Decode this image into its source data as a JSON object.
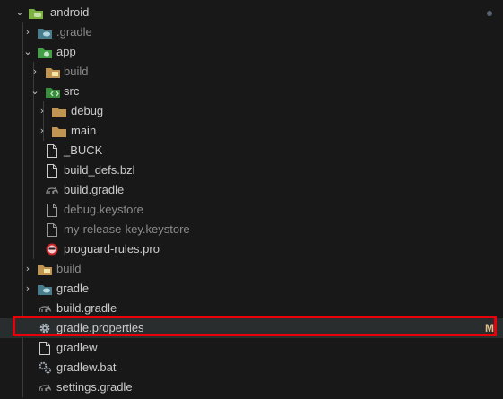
{
  "explorer": {
    "root": {
      "label": "android",
      "icon": "android-folder-icon",
      "expanded": true
    },
    "items": [
      {
        "label": "android",
        "icon": "android-folder-icon",
        "type": "folder",
        "expanded": true,
        "muted": false
      },
      {
        "label": ".gradle",
        "icon": "gradle-folder-icon",
        "type": "folder",
        "expanded": false,
        "muted": true
      },
      {
        "label": "app",
        "icon": "app-folder-icon",
        "type": "folder",
        "expanded": true,
        "muted": false
      },
      {
        "label": "build",
        "icon": "build-folder-icon",
        "type": "folder",
        "expanded": false,
        "muted": true
      },
      {
        "label": "src",
        "icon": "src-folder-icon",
        "type": "folder",
        "expanded": true,
        "muted": false
      },
      {
        "label": "debug",
        "icon": "folder-icon",
        "type": "folder",
        "expanded": false,
        "muted": false
      },
      {
        "label": "main",
        "icon": "folder-icon",
        "type": "folder",
        "expanded": false,
        "muted": false
      },
      {
        "label": "_BUCK",
        "icon": "file-icon",
        "type": "file",
        "muted": false
      },
      {
        "label": "build_defs.bzl",
        "icon": "file-icon",
        "type": "file",
        "muted": false
      },
      {
        "label": "build.gradle",
        "icon": "gradle-file-icon",
        "type": "file",
        "muted": false
      },
      {
        "label": "debug.keystore",
        "icon": "file-icon",
        "type": "file",
        "muted": true
      },
      {
        "label": "my-release-key.keystore",
        "icon": "file-icon",
        "type": "file",
        "muted": true
      },
      {
        "label": "proguard-rules.pro",
        "icon": "proguard-icon",
        "type": "file",
        "muted": false
      },
      {
        "label": "build",
        "icon": "build-folder-icon",
        "type": "folder",
        "expanded": false,
        "muted": true
      },
      {
        "label": "gradle",
        "icon": "gradle-folder-icon",
        "type": "folder",
        "expanded": false,
        "muted": false
      },
      {
        "label": "build.gradle",
        "icon": "gradle-file-icon",
        "type": "file",
        "muted": false
      },
      {
        "label": "gradle.properties",
        "icon": "gear-icon",
        "type": "file",
        "muted": false,
        "badge": "M"
      },
      {
        "label": "gradlew",
        "icon": "file-icon",
        "type": "file",
        "muted": false
      },
      {
        "label": "gradlew.bat",
        "icon": "gears-icon",
        "type": "file",
        "muted": false
      },
      {
        "label": "settings.gradle",
        "icon": "gradle-file-icon",
        "type": "file",
        "muted": false
      }
    ]
  },
  "colors": {
    "background": "#181818",
    "highlight_border": "#e8000b",
    "modified_badge": "#e2c08d",
    "folder": "#c09553",
    "android_green": "#8bc34a"
  }
}
